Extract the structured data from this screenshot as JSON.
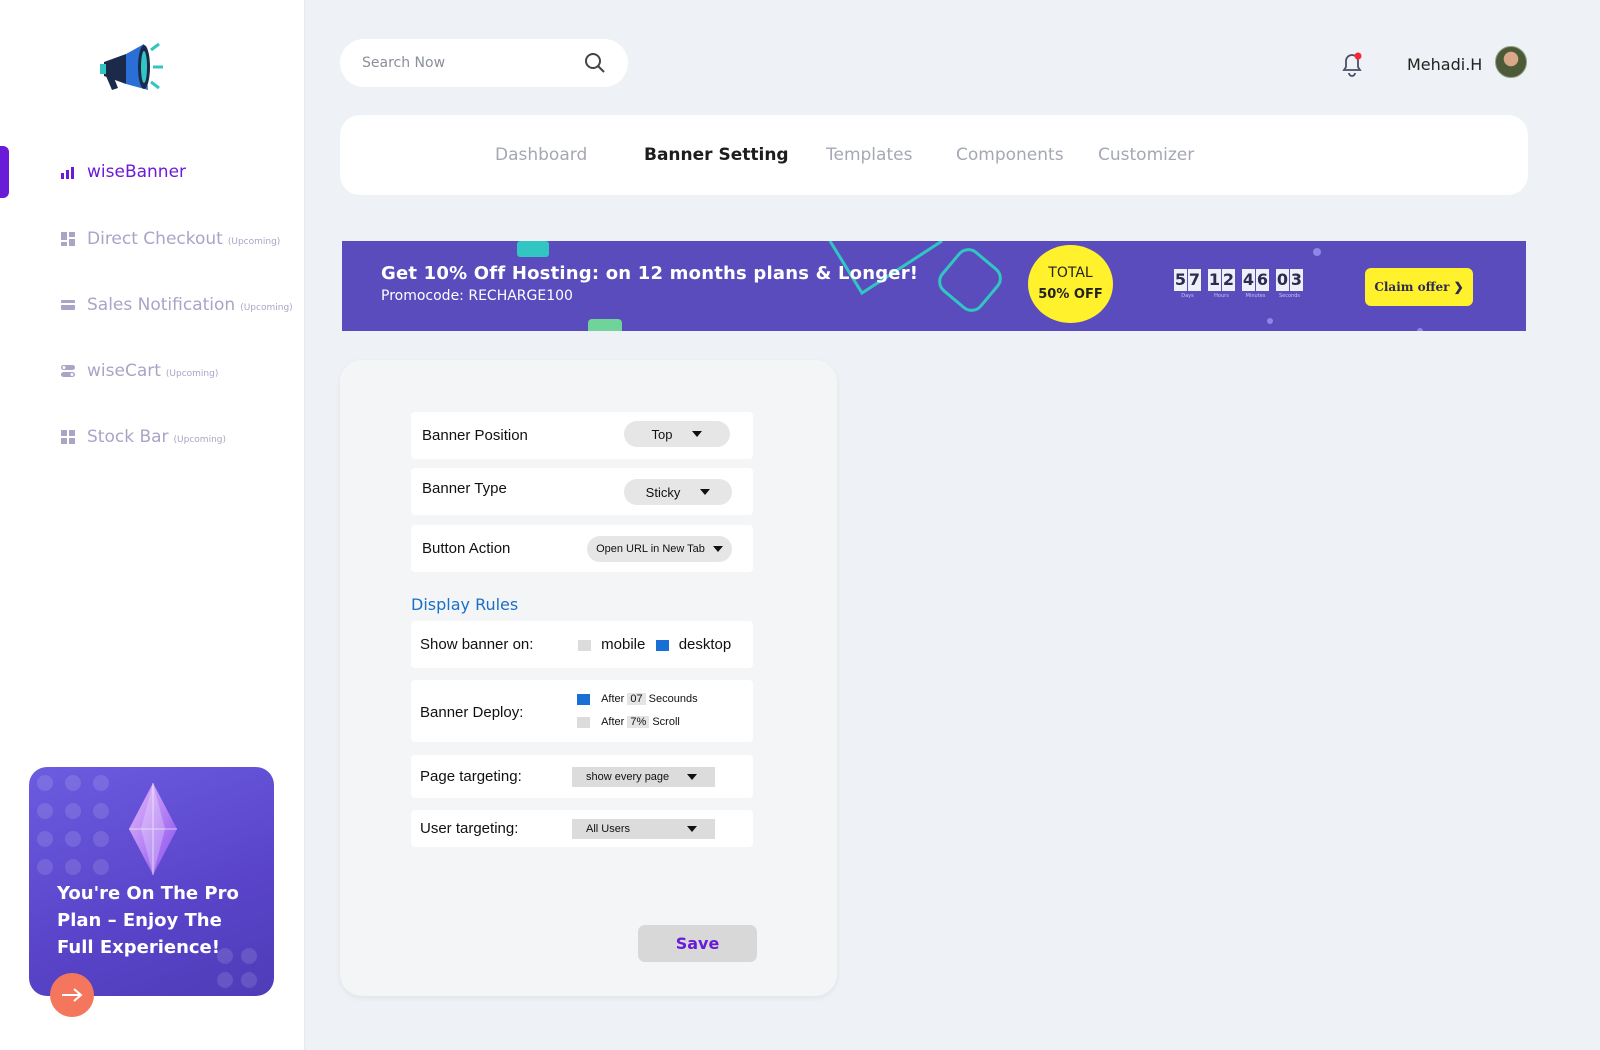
{
  "sidebar": {
    "items": [
      {
        "label": "wiseBanner",
        "tag": ""
      },
      {
        "label": "Direct Checkout",
        "tag": "(Upcoming)"
      },
      {
        "label": "Sales Notification",
        "tag": "(Upcoming)"
      },
      {
        "label": "wiseCart",
        "tag": "(Upcoming)"
      },
      {
        "label": "Stock Bar",
        "tag": "(Upcoming)"
      }
    ],
    "pro_card": {
      "text": "You're On The Pro Plan – Enjoy The Full Experience!"
    }
  },
  "header": {
    "search_placeholder": "Search Now",
    "user_name": "Mehadi.H"
  },
  "tabs": [
    "Dashboard",
    "Banner Setting",
    "Templates",
    "Components",
    "Customizer"
  ],
  "banner": {
    "title": "Get 10% Off Hosting: on 12 months plans & Longer!",
    "promo": "Promocode: RECHARGE100",
    "offer_l1": "TOTAL",
    "offer_l2": "50% OFF",
    "countdown": {
      "days": "57",
      "hours": "12",
      "minutes": "46",
      "seconds": "03",
      "days_label": "Days",
      "hours_label": "Hours",
      "minutes_label": "Minutes",
      "seconds_label": "Seconds"
    },
    "cta": "Claim offer ❯",
    "bg_color": "#5a4cbd",
    "accent_color": "#fff12c"
  },
  "settings": {
    "position_label": "Banner Position",
    "position_value": "Top",
    "type_label": "Banner Type",
    "type_value": "Sticky",
    "action_label": "Button Action",
    "action_value": "Open URL in New Tab",
    "display_rules_title": "Display Rules",
    "show_on_label": "Show banner on:",
    "mobile_label": "mobile",
    "desktop_label": "desktop",
    "deploy_label": "Banner Deploy:",
    "deploy_after": "After",
    "deploy_seconds_value": "07",
    "deploy_seconds_unit": "Secounds",
    "deploy_scroll_value": "7%",
    "deploy_scroll_unit": "Scroll",
    "page_targeting_label": "Page targeting:",
    "page_targeting_value": "show every page",
    "user_targeting_label": "User targeting:",
    "user_targeting_value": "All Users",
    "save_label": "Save"
  },
  "colors": {
    "brand": "#6a1bd8",
    "checkbox_on": "#1a6fd6",
    "link_blue": "#1b6fc5"
  }
}
